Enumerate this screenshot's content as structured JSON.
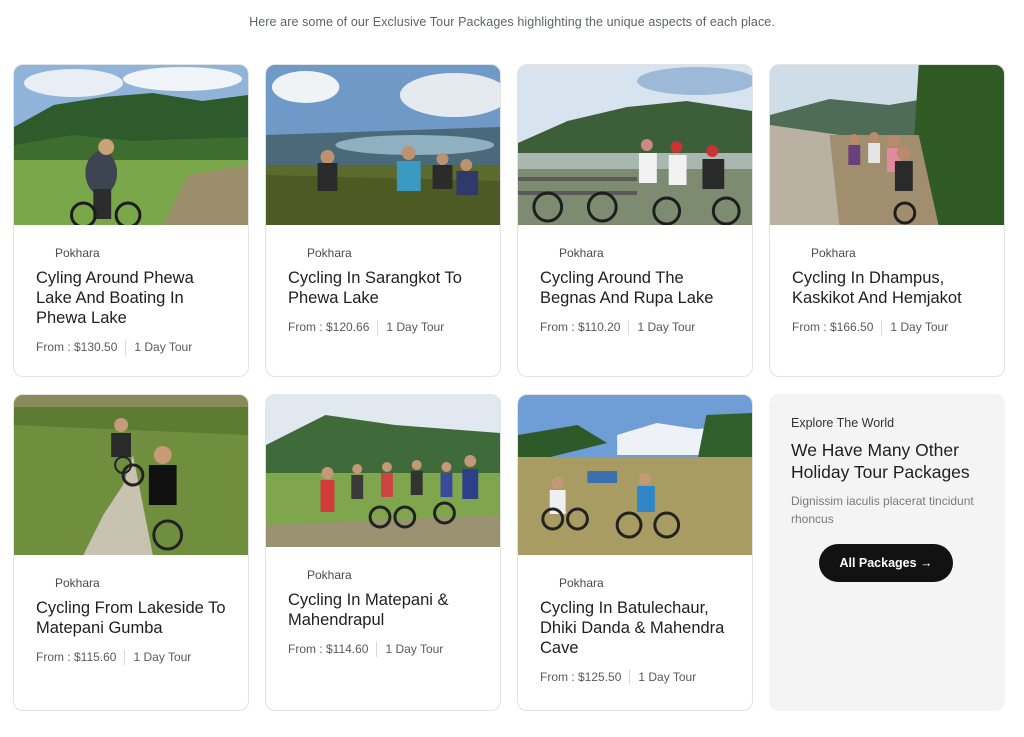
{
  "intro": "Here are some of our Exclusive Tour Packages highlighting the unique aspects of each place.",
  "cards": [
    {
      "location": "Pokhara",
      "title": "Cyling Around Phewa Lake And Boating In Phewa Lake",
      "price": "From : $130.50",
      "duration": "1 Day Tour"
    },
    {
      "location": "Pokhara",
      "title": "Cycling In Sarangkot To Phewa Lake",
      "price": "From : $120.66",
      "duration": "1 Day Tour"
    },
    {
      "location": "Pokhara",
      "title": "Cycling Around The Begnas And Rupa Lake",
      "price": "From : $110.20",
      "duration": "1 Day Tour"
    },
    {
      "location": "Pokhara",
      "title": "Cycling In Dhampus, Kaskikot And Hemjakot",
      "price": "From : $166.50",
      "duration": "1 Day Tour"
    },
    {
      "location": "Pokhara",
      "title": "Cycling From Lakeside To Matepani Gumba",
      "price": "From : $115.60",
      "duration": "1 Day Tour"
    },
    {
      "location": "Pokhara",
      "title": "Cycling In Matepani & Mahendrapul",
      "price": "From : $114.60",
      "duration": "1 Day Tour"
    },
    {
      "location": "Pokhara",
      "title": "Cycling In Batulechaur, Dhiki Danda & Mahendra Cave",
      "price": "From : $125.50",
      "duration": "1 Day Tour"
    }
  ],
  "promo": {
    "kicker": "Explore The World",
    "heading": "We Have Many Other Holiday Tour Packages",
    "description": "Dignissim iaculis placerat tincidunt rhoncus",
    "button_label": "All Packages →"
  },
  "icons": {
    "location": "map-pin-icon"
  },
  "colors": {
    "button": "#121212",
    "promo_bg": "#f4f4f4",
    "card_border": "#e3e3e3"
  }
}
